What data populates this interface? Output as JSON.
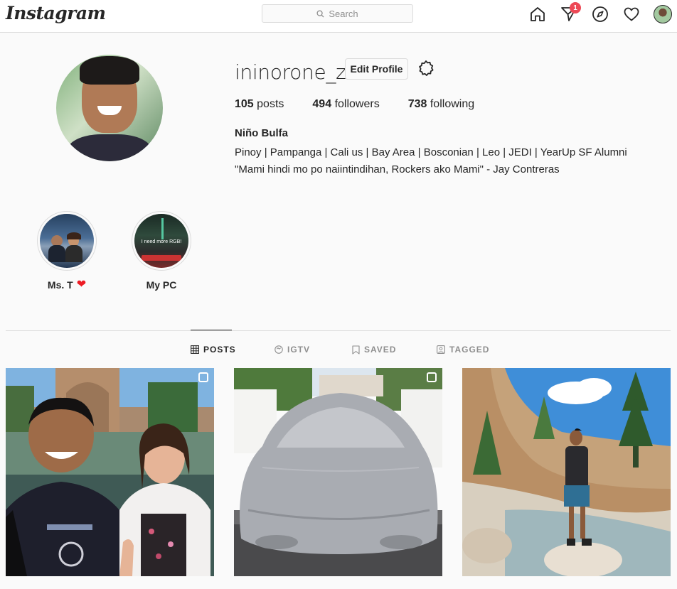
{
  "nav": {
    "logo": "Instagram",
    "search_placeholder": "Search",
    "notification_count": "1",
    "icons": [
      "home-icon",
      "direct-icon",
      "explore-icon",
      "activity-heart-icon",
      "avatar"
    ]
  },
  "profile": {
    "username": "ininorone_z",
    "edit_label": "Edit Profile",
    "posts_count": "105",
    "posts_label": "posts",
    "followers_count": "494",
    "followers_label": "followers",
    "following_count": "738",
    "following_label": "following",
    "full_name": "Niño Bulfa",
    "bio_line1": "Pinoy | Pampanga | Cali us | Bay Area | Bosconian | Leo | JEDI | YearUp SF Alumni",
    "bio_line2": "\"Mami hindi mo po naiintindihan, Rockers ako Mami\" - Jay Contreras"
  },
  "highlights": [
    {
      "label": "Ms. T",
      "emoji": "❤"
    },
    {
      "label": "My PC",
      "overlay_text": "I need more RGB!"
    }
  ],
  "tabs": [
    {
      "label": "POSTS",
      "icon": "grid-icon"
    },
    {
      "label": "IGTV",
      "icon": "igtv-icon"
    },
    {
      "label": "SAVED",
      "icon": "bookmark-icon"
    },
    {
      "label": "TAGGED",
      "icon": "tagged-icon"
    }
  ],
  "posts": [
    {
      "scene": "couple-selfie-palace-of-fine-arts",
      "multi": true
    },
    {
      "scene": "covered-car",
      "multi": true
    },
    {
      "scene": "canyon-hiker",
      "multi": false
    }
  ],
  "colors": {
    "background": "#fafafa",
    "border": "#dbdbdb",
    "text": "#262626",
    "muted": "#8e8e8e",
    "badge": "#ed4956",
    "heart": "#ed1c24"
  }
}
